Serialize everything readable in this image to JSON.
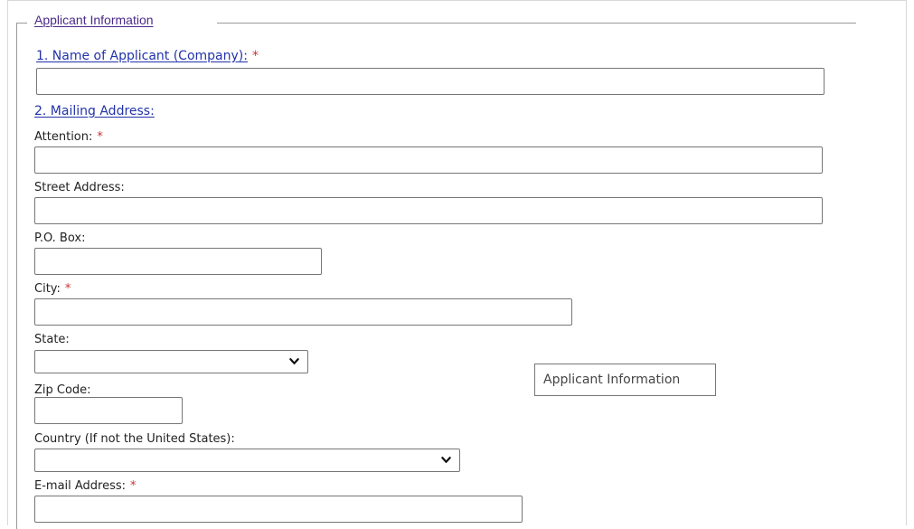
{
  "fieldset": {
    "legend": "Applicant Information"
  },
  "questions": {
    "q1_label": "1. Name of Applicant (Company):",
    "q2_label": "2. Mailing Address:"
  },
  "required_marker": "*",
  "fields": {
    "company_name": {
      "value": ""
    },
    "attention": {
      "label": "Attention:",
      "value": ""
    },
    "street": {
      "label": "Street Address:",
      "value": ""
    },
    "po_box": {
      "label": "P.O. Box:",
      "value": ""
    },
    "city": {
      "label": "City:",
      "value": ""
    },
    "state": {
      "label": "State:",
      "selected": ""
    },
    "zip": {
      "label": "Zip Code:",
      "value": ""
    },
    "country": {
      "label": "Country (If not the United States):",
      "selected": ""
    },
    "email": {
      "label": "E-mail Address:",
      "value": ""
    }
  },
  "tooltip": {
    "text": "Applicant Information"
  },
  "icons": {
    "select_arrow": "chevron-down-icon"
  },
  "colors": {
    "legend": "#4b2a8a",
    "question_label": "#2233aa",
    "required": "#d03030",
    "input_border": "#767676",
    "fieldset_line": "#9a9a9a"
  }
}
